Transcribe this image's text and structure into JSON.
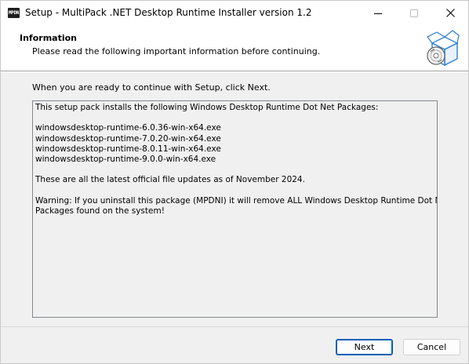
{
  "window": {
    "title": "Setup - MultiPack .NET Desktop Runtime Installer version 1.2",
    "app_icon_text": "MPDN"
  },
  "header": {
    "title": "Information",
    "subtitle": "Please read the following important information before continuing."
  },
  "body": {
    "ready_text": "When you are ready to continue with Setup, click Next.",
    "info_lines": [
      "This setup pack installs the following Windows Desktop Runtime Dot Net Packages:",
      "",
      "windowsdesktop-runtime-6.0.36-win-x64.exe",
      "windowsdesktop-runtime-7.0.20-win-x64.exe",
      "windowsdesktop-runtime-8.0.11-win-x64.exe",
      "windowsdesktop-runtime-9.0.0-win-x64.exe",
      "",
      "These are all the latest official file updates as of November 2024.",
      "",
      "Warning: If you uninstall this package (MPDNI) it will remove ALL Windows Desktop Runtime Dot Net",
      "Packages found on the system!"
    ]
  },
  "buttons": {
    "next": "Next",
    "cancel": "Cancel"
  },
  "icons": {
    "app": "mpdn-app-icon",
    "minimize": "minimize-icon",
    "maximize": "maximize-icon",
    "close": "close-icon",
    "setup": "box-with-disc-icon"
  },
  "colors": {
    "accent": "#005fb8",
    "setup_icon_blue": "#3a8fd6"
  }
}
